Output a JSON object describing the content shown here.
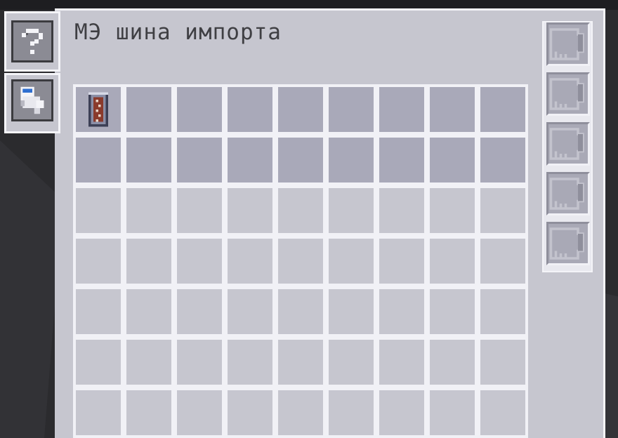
{
  "window": {
    "title": "МЭ шина импорта"
  },
  "side_tabs": [
    {
      "name": "help",
      "icon": "question-mark-icon",
      "glyph": "?"
    },
    {
      "name": "priority",
      "icon": "hopper-icon"
    }
  ],
  "upgrade_slots": {
    "count": 5,
    "icon": "empty-upgrade-card-icon"
  },
  "filter_grid": {
    "columns": 9,
    "rows": 7,
    "active_rows": 2,
    "filled_slots": [
      {
        "row": 0,
        "col": 0,
        "item_icon": "storage-item-icon"
      }
    ]
  },
  "colors": {
    "panel": "#c6c6cf",
    "active_slot": "#a9a9b9",
    "inactive_slot": "#c6c6cf",
    "text": "#3f3f43"
  }
}
